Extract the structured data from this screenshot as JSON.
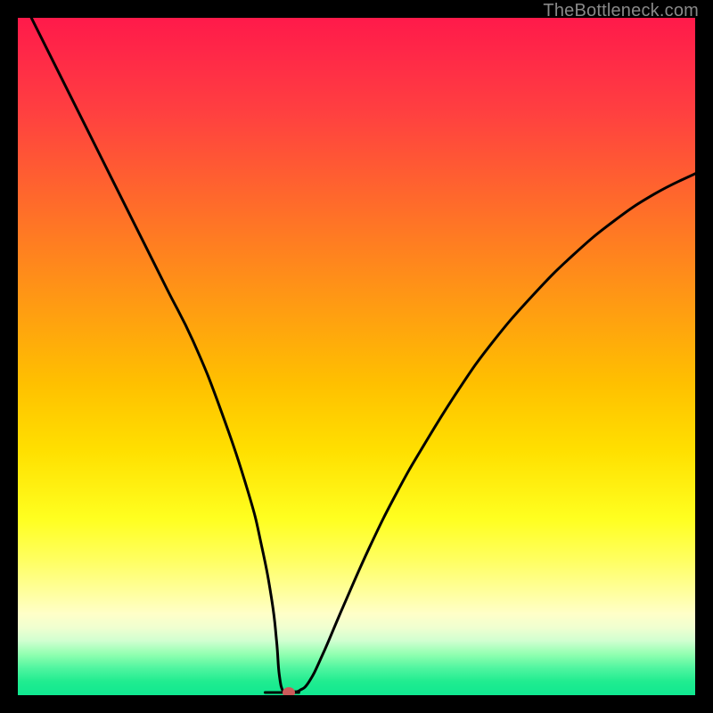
{
  "watermark": "TheBottleneck.com",
  "chart_data": {
    "type": "line",
    "title": "",
    "xlabel": "",
    "ylabel": "",
    "xlim": [
      0,
      100
    ],
    "ylim": [
      0,
      100
    ],
    "background_gradient": {
      "top": "#ff1a4a",
      "mid": "#ffe000",
      "bottom": "#10e890"
    },
    "series": [
      {
        "name": "bottleneck-curve",
        "color": "#000000",
        "x": [
          2,
          6,
          10,
          14,
          18,
          22,
          26,
          30,
          34,
          36,
          37.5,
          38.2,
          38.6,
          39.2,
          40.0,
          40.8,
          41.6,
          43,
          45,
          48,
          52,
          56,
          60,
          65,
          70,
          76,
          82,
          88,
          94,
          100
        ],
        "y": [
          100,
          92,
          84,
          76,
          68,
          60,
          52,
          42,
          30,
          22,
          14,
          8,
          3,
          0.5,
          0.4,
          0.5,
          0.7,
          2,
          6,
          13,
          22,
          30,
          37,
          45,
          52,
          59,
          65,
          70,
          74,
          77
        ]
      }
    ],
    "marker": {
      "x": 40.0,
      "y": 0.4,
      "color": "#cc5a5a"
    },
    "optimal_zone": {
      "x_start": 36.5,
      "x_end": 41.5,
      "y": 0.4
    }
  }
}
